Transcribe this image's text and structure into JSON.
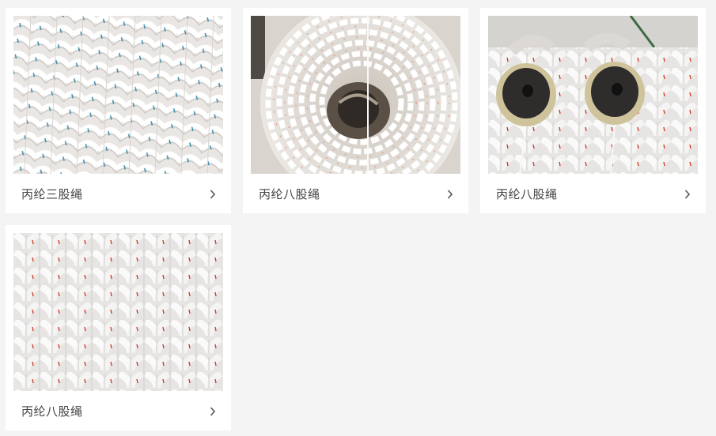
{
  "products": [
    {
      "name": "丙纶三股绳",
      "image": "three-strand-rope-photo"
    },
    {
      "name": "丙纶八股绳",
      "image": "eight-strand-rope-coil-photo"
    },
    {
      "name": "丙纶八股绳",
      "image": "eight-strand-rope-thimble-photo"
    },
    {
      "name": "丙纶八股绳",
      "image": "eight-strand-rope-closeup-photo"
    }
  ],
  "colors": {
    "page_bg": "#f4f4f4",
    "card_bg": "#ffffff",
    "caption": "#444444",
    "chevron": "#555555"
  },
  "icons": {
    "card_arrow": "chevron-right-icon"
  }
}
